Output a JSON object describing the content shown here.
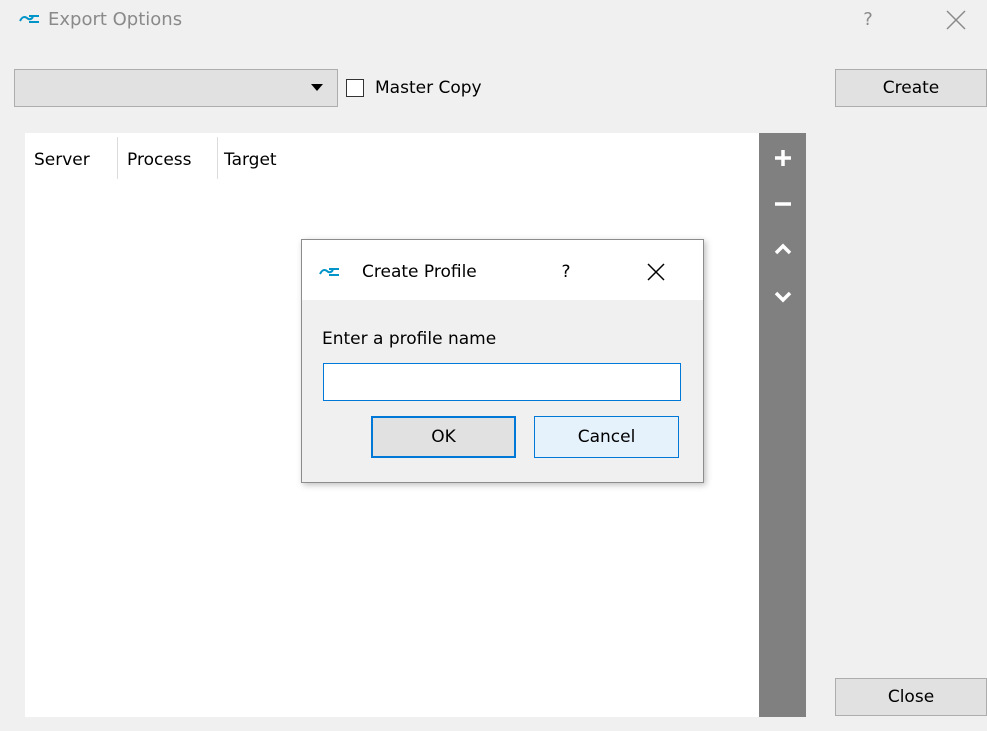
{
  "window": {
    "title": "Export Options",
    "help_label": "?",
    "app_icon": "app-logo-icon",
    "close_icon": "close-icon"
  },
  "toolbar": {
    "profile_select_value": "",
    "master_copy_label": "Master Copy",
    "master_copy_checked": false,
    "create_label": "Create",
    "close_label": "Close"
  },
  "table": {
    "columns": [
      "Server",
      "Process",
      "Target"
    ],
    "rows": []
  },
  "tool_strip": {
    "icons": [
      "plus-icon",
      "minus-icon",
      "chevron-up-icon",
      "chevron-down-icon"
    ]
  },
  "dialog": {
    "title": "Create Profile",
    "help_label": "?",
    "prompt": "Enter a profile name",
    "input_value": "",
    "ok_label": "OK",
    "cancel_label": "Cancel"
  },
  "colors": {
    "window_bg": "#f0f0f0",
    "tool_strip_bg": "#808080",
    "accent": "#0078d7",
    "button_bg": "#e1e1e1"
  }
}
